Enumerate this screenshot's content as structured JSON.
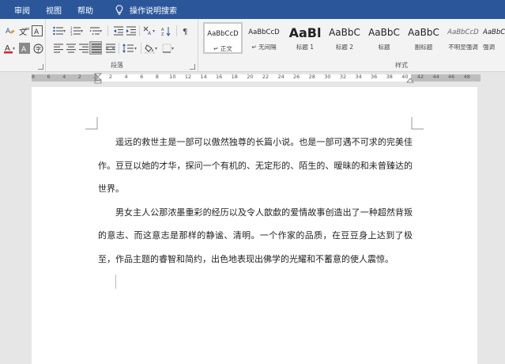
{
  "menu": {
    "items": [
      "审阅",
      "视图",
      "帮助"
    ],
    "tell_me": "操作说明搜索"
  },
  "ribbon": {
    "para_group_label": "段落",
    "styles_group_label": "样式",
    "styles": [
      {
        "preview": "AaBbCcD",
        "name": "↵ 正文"
      },
      {
        "preview": "AaBbCcD",
        "name": "↵ 无间隔"
      },
      {
        "preview": "AaBl",
        "name": "标题 1"
      },
      {
        "preview": "AaBbC",
        "name": "标题 2"
      },
      {
        "preview": "AaBbC",
        "name": "标题"
      },
      {
        "preview": "AaBbC",
        "name": "副标题"
      },
      {
        "preview": "AaBbCcD",
        "name": "不明显强调"
      },
      {
        "preview": "AaBbC",
        "name": "强调"
      }
    ],
    "accent": "#2b579a",
    "font_color": "#e02020"
  },
  "ruler": {
    "labels": [
      "8",
      "6",
      "4",
      "2",
      "2",
      "2",
      "4",
      "6",
      "8",
      "10",
      "12",
      "14",
      "16",
      "18",
      "20",
      "22",
      "24",
      "26",
      "28",
      "30",
      "32",
      "34",
      "36",
      "38",
      "40",
      "42",
      "44",
      "46",
      "48"
    ]
  },
  "document": {
    "paragraphs": [
      "遥远的救世主是一部可以傲然独尊的长篇小说。也是一部可遇不可求的完美佳作。豆豆以她的才华，探问一个有机的、无定形的、陌生的、暧昧的和未曾臻达的世界。",
      "男女主人公那浓墨重彩的经历以及令人歆歔的爱情故事创造出了一种超然背叛的意志、而这意志是那样的静谧、清明。一个作家的品质，在豆豆身上达到了极至，作品主题的睿智和简约，出色地表现出佛学的光耀和不蓄意的使人震惊。"
    ]
  }
}
